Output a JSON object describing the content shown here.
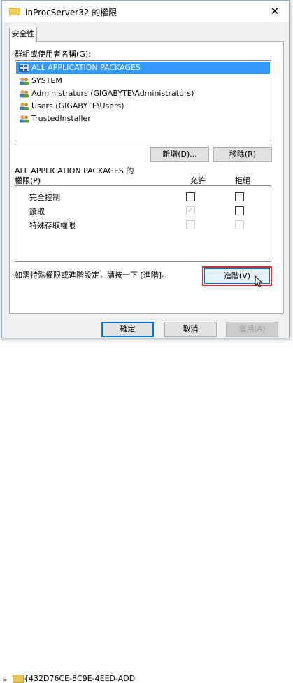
{
  "dialog": {
    "title": "InProcServer32 的權限",
    "tab": "安全性",
    "close_glyph": "✕"
  },
  "groups": {
    "label": "群組或使用者名稱(G):",
    "items": [
      {
        "label": "ALL APPLICATION PACKAGES",
        "selected": true,
        "icon": "packages-icon"
      },
      {
        "label": "SYSTEM",
        "selected": false,
        "icon": "users-icon"
      },
      {
        "label": "Administrators (GIGABYTE\\Administrators)",
        "selected": false,
        "icon": "users-icon"
      },
      {
        "label": "Users (GIGABYTE\\Users)",
        "selected": false,
        "icon": "users-icon"
      },
      {
        "label": "TrustedInstaller",
        "selected": false,
        "icon": "users-icon"
      }
    ],
    "add_label": "新增(D)...",
    "remove_label": "移除(R)"
  },
  "permissions": {
    "title_line1": "ALL APPLICATION PACKAGES 的",
    "title_line2": "權限(P)",
    "allow_header": "允許",
    "deny_header": "拒絕",
    "rows": [
      {
        "label": "完全控制",
        "allow": false,
        "deny": false,
        "enabled": true
      },
      {
        "label": "讀取",
        "allow": true,
        "deny": false,
        "enabled": true,
        "allow_disabled": true
      },
      {
        "label": "特殊存取權限",
        "allow": false,
        "deny": false,
        "enabled": false
      }
    ]
  },
  "advanced": {
    "hint": "如需特殊權限或進階設定，請按一下 [進階]。",
    "button_label": "進階(V)"
  },
  "footer": {
    "ok_label": "確定",
    "cancel_label": "取消",
    "apply_label": "套用(A)"
  },
  "background": {
    "item_text": "{432D76CE-8C9E-4EED-ADD"
  },
  "colors": {
    "selection": "#3399ff",
    "highlight_box": "#e0242e"
  }
}
